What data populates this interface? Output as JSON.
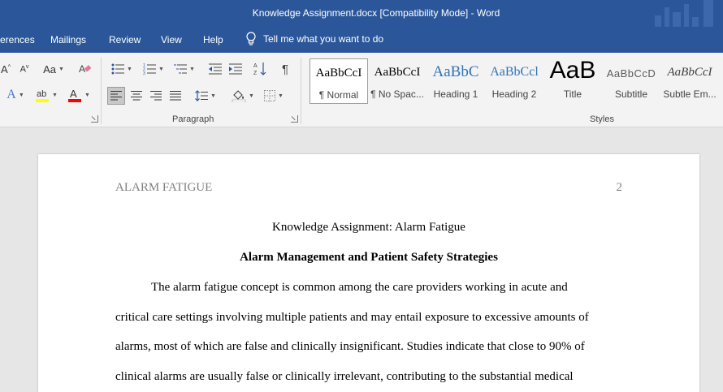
{
  "window": {
    "title": "Knowledge Assignment.docx [Compatibility Mode]  -  Word"
  },
  "tabs": {
    "items": [
      "erences",
      "Mailings",
      "Review",
      "View",
      "Help"
    ],
    "tell_me": "Tell me what you want to do"
  },
  "ribbon": {
    "font": {
      "case_label": "Aa"
    },
    "paragraph": {
      "label": "Paragraph"
    },
    "styles": {
      "label": "Styles",
      "items": [
        {
          "sample": "AaBbCcI",
          "name": "¶ Normal"
        },
        {
          "sample": "AaBbCcI",
          "name": "¶ No Spac..."
        },
        {
          "sample": "AaBbC",
          "name": "Heading 1"
        },
        {
          "sample": "AaBbCcl",
          "name": "Heading 2"
        },
        {
          "sample": "AaB",
          "name": "Title"
        },
        {
          "sample": "AaBbCcD",
          "name": "Subtitle"
        },
        {
          "sample": "AaBbCcI",
          "name": "Subtle Em..."
        }
      ]
    }
  },
  "colors": {
    "brand": "#2b579a",
    "highlight": "#ffff00",
    "font_color": "#ff0000"
  },
  "document": {
    "header_left": "ALARM FATIGUE",
    "page_number": "2",
    "title": "Knowledge Assignment: Alarm Fatigue",
    "heading": "Alarm Management and Patient Safety Strategies",
    "lines": [
      "The alarm fatigue concept is common among the care providers working in acute and",
      "critical care settings involving multiple patients and may entail exposure to excessive amounts of",
      "alarms, most of which are false and clinically insignificant. Studies indicate that close to 90% of",
      "clinical alarms are usually false or clinically irrelevant, contributing to the substantial medical"
    ]
  }
}
